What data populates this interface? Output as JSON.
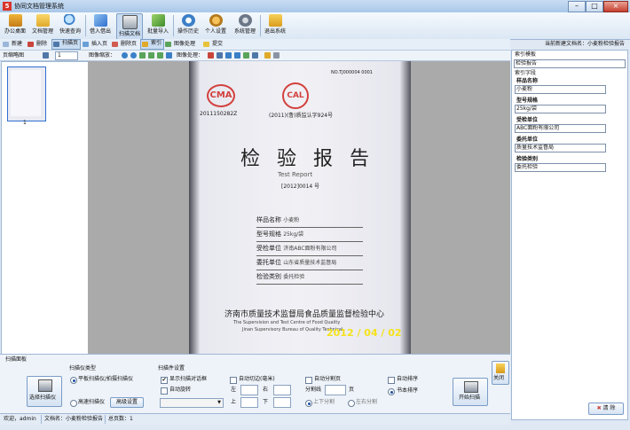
{
  "window": {
    "title": "协同文档管理系统",
    "app_icon": "5"
  },
  "toolbar": {
    "buttons": [
      {
        "label": "办公桌面",
        "icon": "home-icon"
      },
      {
        "label": "文档管理",
        "icon": "folder-icon"
      },
      {
        "label": "快速查询",
        "icon": "search-icon"
      },
      {
        "label": "借入借出",
        "icon": "borrow-icon"
      },
      {
        "label": "扫描文档",
        "icon": "scanner-icon"
      },
      {
        "label": "批量导入",
        "icon": "import-icon"
      },
      {
        "label": "操作历史",
        "icon": "history-icon"
      },
      {
        "label": "个人设置",
        "icon": "user-settings-icon"
      },
      {
        "label": "系统管理",
        "icon": "gear-icon"
      },
      {
        "label": "退出系统",
        "icon": "exit-icon"
      }
    ]
  },
  "current_doc": "当前新建文档名：小麦粉检验报告",
  "toolbar2": {
    "items": [
      "新建",
      "删除",
      "扫描页",
      "插入页",
      "删除页",
      "索引",
      "图像处理",
      "提交"
    ]
  },
  "toolbar3": {
    "thumb_label": "页缩略图",
    "page_value": "1",
    "zoom_label": "图像缩放：",
    "process_label": "图像处理："
  },
  "thumbnails": [
    {
      "number": "1"
    }
  ],
  "document": {
    "code": "NO.TJ000004 0001",
    "cma": "CMA",
    "cal": "CAL",
    "cert_left": "2011150282Z",
    "cert_right": "(2011)(鲁)质监认字924号",
    "title": "检 验 报 告",
    "subtitle_en": "Test   Report",
    "report_no": "[2012]0014 号",
    "fields": [
      {
        "label": "样品名称",
        "value": "小麦粉"
      },
      {
        "label": "型号规格",
        "value": "25kg/袋"
      },
      {
        "label": "受检单位",
        "value": "济南ABC面粉有限公司"
      },
      {
        "label": "委托单位",
        "value": "山东省质量技术监督局"
      },
      {
        "label": "检验类别",
        "value": "委托检验"
      }
    ],
    "org_cn": "济南市质量技术监督局食品质量监督检验中心",
    "org_en_1": "The  Supervision  and  Test  Centre  of  Food  Quality",
    "org_en_2": "Jinan  Supervisory  Bureau  of  Quality  Technical",
    "date_stamp": "2012 / 04 / 02"
  },
  "right_panel": {
    "template_label": "索引模板",
    "template_value": "检验报告",
    "fields_header": "索引字段",
    "fields": [
      {
        "label": "样品名称",
        "value": "小麦粉"
      },
      {
        "label": "型号规格",
        "value": "25kg/袋"
      },
      {
        "label": "受检单位",
        "value": "ABC面粉有限公司"
      },
      {
        "label": "委托单位",
        "value": "质量技术监督局"
      },
      {
        "label": "检验类别",
        "value": "委托检验"
      }
    ],
    "clear_label": "清 除"
  },
  "scan_panel": {
    "title": "扫描面板",
    "select_scanner": "选择扫描仪",
    "scanner_type_label": "扫描仪类型",
    "radio_flatbed": "平板扫描仪/拍摄扫描仪",
    "radio_highspeed": "高速扫描仪",
    "advanced_btn": "高级设置",
    "settings_label": "扫描件设置",
    "show_dialog": "显示扫描对话框",
    "auto_rotate": "自动旋转",
    "auto_crop": "自动切边(毫米)",
    "left_label": "左",
    "right_label": "右",
    "top_label": "上",
    "bottom_label": "下",
    "auto_split": "自动分割页",
    "split_label": "分割线",
    "page_label": "页",
    "radio_updown": "上下分割",
    "radio_leftright": "左右分割",
    "auto_sort": "自动排序",
    "book_sort": "书本排序",
    "start_scan": "开始扫描",
    "close_label": "关闭"
  },
  "status": {
    "welcome": "欢迎，admin",
    "docname_label": "文档名：小麦粉检验报告",
    "pages_label": "总页数：1"
  },
  "colors": {
    "accent": "#2f6fd0",
    "stamp_red": "#d2413d",
    "date_yellow": "#f5e21a"
  }
}
